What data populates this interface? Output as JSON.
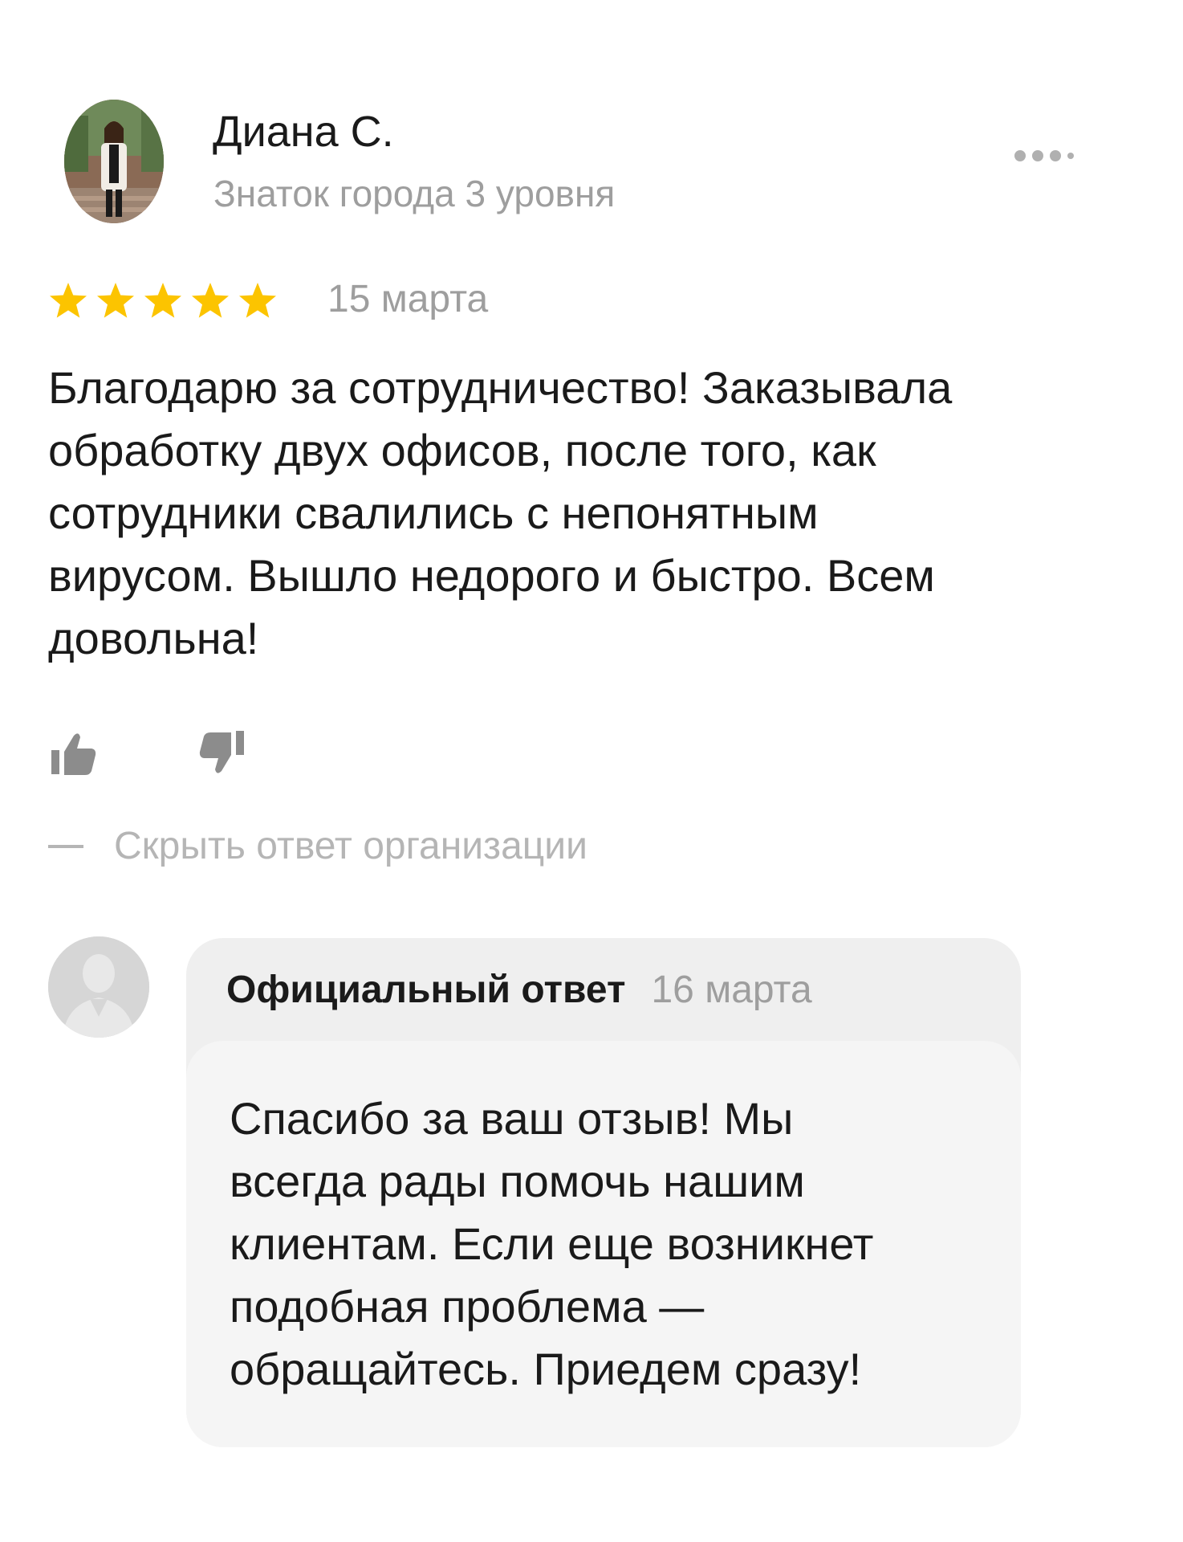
{
  "author": {
    "name": "Диана С.",
    "level": "Знаток города 3 уровня",
    "avatar_icon": "user-photo-avatar"
  },
  "review": {
    "rating": 5,
    "rating_max": 5,
    "star_color": "#fcc400",
    "date": "15 марта",
    "lines": [
      "Благодарю за сотрудничество! Заказывала",
      "обработку двух офисов, после того, как",
      "сотрудники свалились с непонятным",
      "вирусом. Вышло недорого и быстро. Всем",
      "довольна!"
    ]
  },
  "actions": {
    "more_icon": "more-dots-icon",
    "like_icon": "thumbs-up-icon",
    "dislike_icon": "thumbs-down-icon",
    "hide_reply_label": "Скрыть ответ организации"
  },
  "org_reply": {
    "avatar_icon": "organization-avatar-placeholder",
    "title": "Официальный ответ",
    "date": "16 марта",
    "lines": [
      "Спасибо за ваш отзыв! Мы",
      "всегда рады помочь нашим",
      "клиентам. Если еще возникнет",
      "подобная проблема —",
      "обращайтесь. Приедем сразу!"
    ]
  }
}
